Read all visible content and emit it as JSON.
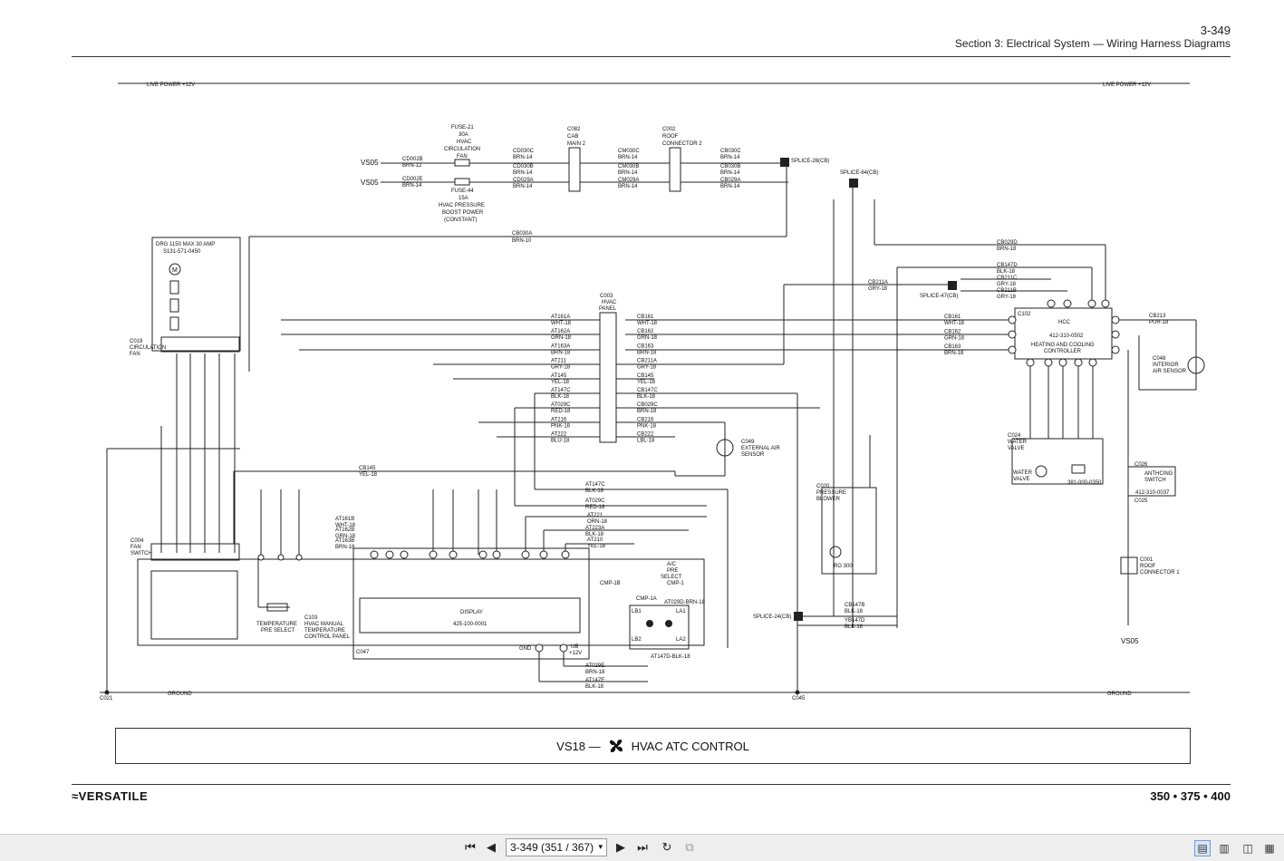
{
  "header": {
    "page_number": "3-349",
    "section_title": "Section 3: Electrical System — Wiring Harness Diagrams"
  },
  "footer": {
    "brand": "VERSATILE",
    "models": "350 • 375 • 400"
  },
  "title_block": {
    "code": "VS18 —",
    "title": "HVAC ATC CONTROL",
    "icon": "fan-icon"
  },
  "diagram": {
    "live_power_left": "LIVE POWER +12V",
    "live_power_right": "LIVE POWER +12V",
    "ground_left": "GROUND",
    "ground_right": "GROUND",
    "vs05_top": "VS05",
    "vs05_bottom": "VS05",
    "vs05_right": "VS05",
    "fuse21": [
      "FUSE-21",
      "30A",
      "HVAC",
      "CIRCULATION",
      "FAN"
    ],
    "fuse44": [
      "FUSE-44",
      "15A",
      "HVAC PRESSURE",
      "BOOST POWER",
      "(CONSTANT)"
    ],
    "c082": [
      "C082",
      "CAB",
      "MAIN 2"
    ],
    "c002": [
      "C002",
      "ROOF",
      "CONNECTOR 2"
    ],
    "splice28": "SPLICE-28(CB)",
    "splice64": "SPLICE-64(CB)",
    "splice47": "SPLICE-47(CB)",
    "splice24": "SPLICE-24(CB)",
    "drg": [
      "DRG 1150 MAX 30 AMP",
      "S131-571-0450"
    ],
    "c019": [
      "C019",
      "CIRCULATION",
      "FAN"
    ],
    "c003": [
      "C003",
      "HVAC",
      "PANEL"
    ],
    "hcc": [
      "HCC",
      "412-310-0502",
      "HEATING AND COOLING",
      "CONTROLLER"
    ],
    "c102": "C102",
    "c048": [
      "C048",
      "INTERIOR",
      "AIR SENSOR"
    ],
    "c049": [
      "C049",
      "EXTERNAL AIR",
      "SENSOR"
    ],
    "c024": [
      "C024",
      "WATER",
      "VALVE"
    ],
    "water_valve": [
      "WATER",
      "VALVE"
    ],
    "valve_part": "381-000-0350",
    "c026": "C026",
    "c025": "C025",
    "antifreeze": [
      "ANTHCING",
      "SWITCH",
      "412-310-0037"
    ],
    "c001": [
      "C001",
      "ROOF",
      "CONNECTOR 1"
    ],
    "c020": [
      "C020",
      "PRESSURE",
      "BLOWER"
    ],
    "rg300": "RG 300",
    "c004": [
      "C004",
      "FAN",
      "SWITCH"
    ],
    "c103": [
      "C103",
      "HVAC MANUAL",
      "TEMPERATURE",
      "CONTROL PANEL"
    ],
    "temp_preselect": [
      "TEMPERATURE",
      "PRE SELECT"
    ],
    "display": [
      "DISPLAY",
      "425-100-0001"
    ],
    "c047": "C047",
    "ac_preselect": [
      "A/C",
      "PRE",
      "SELECT"
    ],
    "c021": "C021",
    "c045": "C045",
    "wires_left": [
      {
        "id": "AT161A",
        "c": "WHT-18"
      },
      {
        "id": "AT162A",
        "c": "GRN-18"
      },
      {
        "id": "AT163A",
        "c": "BRN-18"
      },
      {
        "id": "AT211",
        "c": "GRY-18"
      },
      {
        "id": "AT145",
        "c": "YEL-18"
      },
      {
        "id": "AT147C",
        "c": "BLK-18"
      },
      {
        "id": "AT029C",
        "c": "RED-18"
      },
      {
        "id": "AT216",
        "c": "PNK-18"
      },
      {
        "id": "AT222",
        "c": "BLU-18"
      }
    ],
    "wires_right": [
      {
        "id": "CB161",
        "c": "WHT-18"
      },
      {
        "id": "CB162",
        "c": "GRN-18"
      },
      {
        "id": "CB163",
        "c": "BRN-18"
      },
      {
        "id": "CB211A",
        "c": "GRY-18"
      },
      {
        "id": "CB145",
        "c": "YEL-18"
      },
      {
        "id": "CB147C",
        "c": "BLK-18"
      },
      {
        "id": "CB029C",
        "c": "BRN-18"
      },
      {
        "id": "CB216",
        "c": "PNK-18"
      },
      {
        "id": "CB222",
        "c": "LBL-18"
      }
    ],
    "hcc_wires": [
      {
        "id": "CB161",
        "c": "WHT-18"
      },
      {
        "id": "CB162",
        "c": "GRN-18"
      },
      {
        "id": "CB163",
        "c": "BRN-18"
      }
    ],
    "cb213": [
      "CB213",
      "PUR-18"
    ],
    "cb029d": [
      "CB029D",
      "BRN-18"
    ],
    "cb147d": [
      "CB147D",
      "BLK-18"
    ],
    "cb211c": [
      "CB211C",
      "GRY-18"
    ],
    "cb211b": [
      "CB211B",
      "GRY-18"
    ],
    "cb211a": [
      "CB211A",
      "GRY-18"
    ],
    "cb030a": [
      "CB030A",
      "BRN-10"
    ],
    "cb145": [
      "CB145",
      "YEL-18"
    ],
    "cb147b": [
      "CB147B",
      "BLK-18"
    ],
    "yb147d": [
      "YB147D",
      "BLK-18"
    ],
    "cd002b": [
      "CD002B",
      "BRN-12"
    ],
    "cd002e": [
      "CD002E",
      "BRN-14"
    ],
    "cd030c": [
      "CD030C",
      "BRN-14"
    ],
    "cd030b": [
      "CD030B",
      "BRN-14"
    ],
    "cd029a": [
      "CD029A",
      "BRN-14"
    ],
    "cm030c": [
      "CM030C",
      "BRN-14"
    ],
    "cm030b": [
      "CM030B",
      "BRN-14"
    ],
    "cm029a": [
      "CM029A",
      "BRN-14"
    ],
    "cb030c": [
      "CB030C",
      "BRN-14"
    ],
    "cb030b": [
      "CB030B",
      "BRN-14"
    ],
    "cb029a": [
      "CB029A",
      "BRN-14"
    ],
    "at_display": [
      {
        "id": "AT161B",
        "c": "WHT-18"
      },
      {
        "id": "AT162B",
        "c": "GRN-18"
      },
      {
        "id": "AT163B",
        "c": "BRN-18"
      }
    ],
    "at_mid": [
      {
        "id": "AT147C",
        "c": "BLK-18"
      },
      {
        "id": "AT029C",
        "c": "RED-18"
      },
      {
        "id": "AT221",
        "c": "ORN-18"
      },
      {
        "id": "AT223A",
        "c": "BLK-18"
      },
      {
        "id": "AT210",
        "c": "YEL-18"
      }
    ],
    "at_bottom": [
      {
        "id": "AT029E",
        "c": "BRN-18"
      },
      {
        "id": "AT147E",
        "c": "BLK-18"
      }
    ],
    "at029d": "AT029D-BRN-18",
    "at147d": "AT147D-BLK-18",
    "gnd": "GND",
    "ub": [
      "UB",
      "+12V"
    ],
    "cmp1b": "CMP-1B",
    "cmp1a": "CMP-1A",
    "cmp1": "CMP-1",
    "lb1": "LB1",
    "lb2": "LB2",
    "la1": "LA1",
    "la2": "LA2"
  },
  "toolbar": {
    "page_field": "3-349 (351 / 367)",
    "first_label": "first-page",
    "prev_label": "previous-page",
    "next_label": "next-page",
    "last_label": "last-page"
  }
}
